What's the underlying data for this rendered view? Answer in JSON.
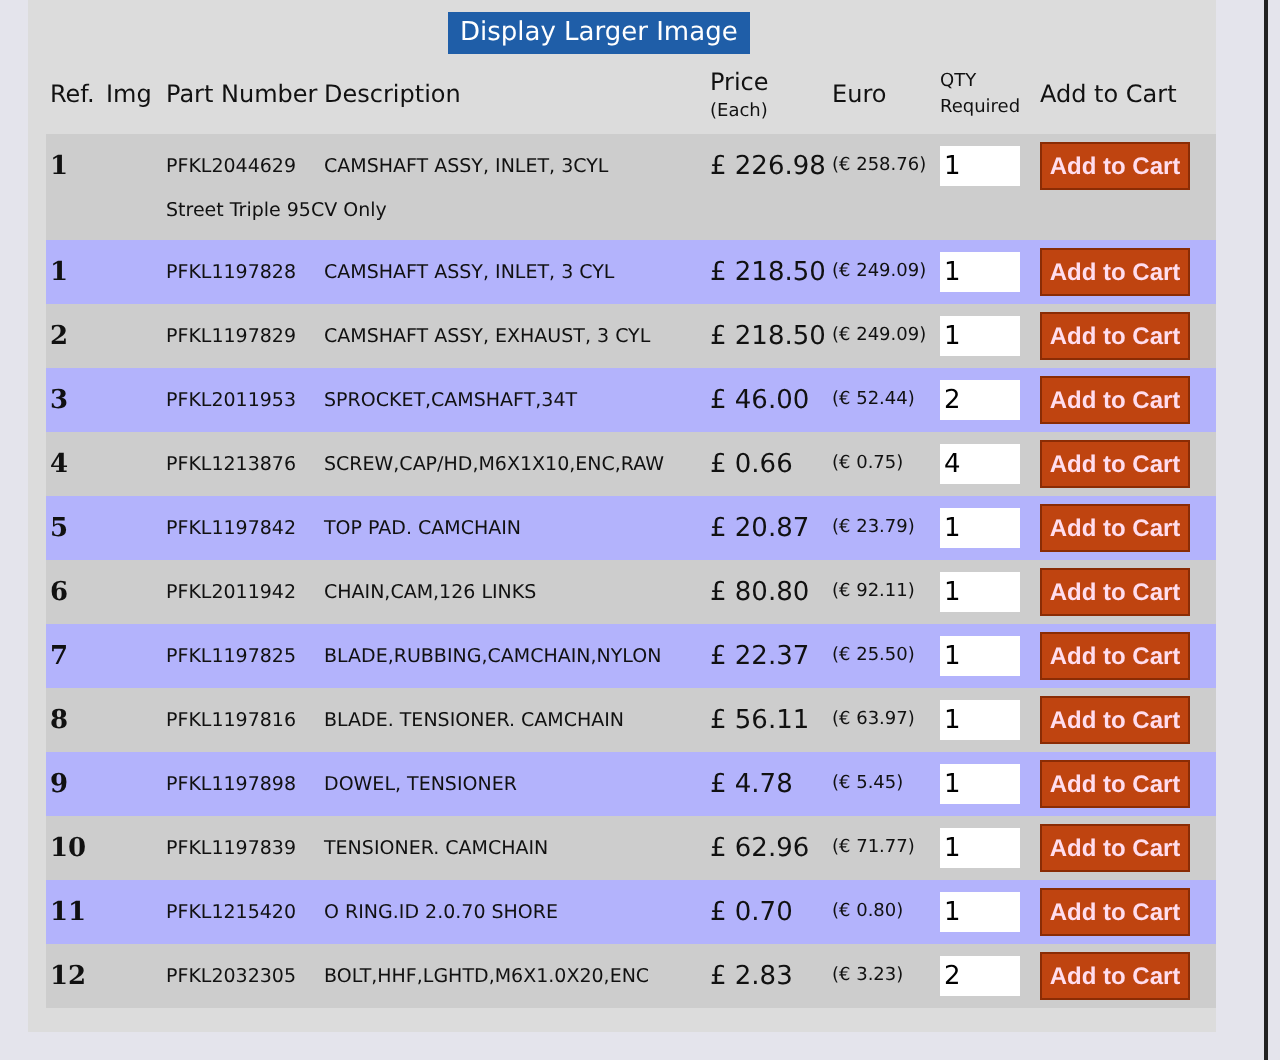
{
  "display_button": "Display Larger Image",
  "columns": [
    {
      "label": "Ref."
    },
    {
      "label": "Img"
    },
    {
      "label": "Part Number"
    },
    {
      "label": "Description"
    },
    {
      "label": "Price",
      "sub": "(Each)"
    },
    {
      "label": "Euro"
    },
    {
      "label": "QTY",
      "sub": "Required"
    },
    {
      "label": "Add to Cart"
    }
  ],
  "rows": [
    {
      "ref": "1",
      "part": "PFKL2044629",
      "description": "CAMSHAFT ASSY, INLET, 3CYL",
      "price": "£ 226.98",
      "euro": "(€ 258.76)",
      "qty": "1",
      "button": "Add to Cart",
      "note": "Street Triple 95CV Only"
    },
    {
      "ref": "1",
      "part": "PFKL1197828",
      "description": "CAMSHAFT ASSY, INLET, 3 CYL",
      "price": "£ 218.50",
      "euro": "(€ 249.09)",
      "qty": "1",
      "button": "Add to Cart"
    },
    {
      "ref": "2",
      "part": "PFKL1197829",
      "description": "CAMSHAFT ASSY, EXHAUST, 3 CYL",
      "price": "£ 218.50",
      "euro": "(€ 249.09)",
      "qty": "1",
      "button": "Add to Cart"
    },
    {
      "ref": "3",
      "part": "PFKL2011953",
      "description": "SPROCKET,CAMSHAFT,34T",
      "price": "£ 46.00",
      "euro": "(€ 52.44)",
      "qty": "2",
      "button": "Add to Cart"
    },
    {
      "ref": "4",
      "part": "PFKL1213876",
      "description": "SCREW,CAP/HD,M6X1X10,ENC,RAW",
      "price": "£ 0.66",
      "euro": "(€ 0.75)",
      "qty": "4",
      "button": "Add to Cart"
    },
    {
      "ref": "5",
      "part": "PFKL1197842",
      "description": "TOP PAD. CAMCHAIN",
      "price": "£ 20.87",
      "euro": "(€ 23.79)",
      "qty": "1",
      "button": "Add to Cart"
    },
    {
      "ref": "6",
      "part": "PFKL2011942",
      "description": "CHAIN,CAM,126 LINKS",
      "price": "£ 80.80",
      "euro": "(€ 92.11)",
      "qty": "1",
      "button": "Add to Cart"
    },
    {
      "ref": "7",
      "part": "PFKL1197825",
      "description": "BLADE,RUBBING,CAMCHAIN,NYLON",
      "price": "£ 22.37",
      "euro": "(€ 25.50)",
      "qty": "1",
      "button": "Add to Cart"
    },
    {
      "ref": "8",
      "part": "PFKL1197816",
      "description": "BLADE. TENSIONER. CAMCHAIN",
      "price": "£ 56.11",
      "euro": "(€ 63.97)",
      "qty": "1",
      "button": "Add to Cart"
    },
    {
      "ref": "9",
      "part": "PFKL1197898",
      "description": "DOWEL, TENSIONER",
      "price": "£ 4.78",
      "euro": "(€ 5.45)",
      "qty": "1",
      "button": "Add to Cart"
    },
    {
      "ref": "10",
      "part": "PFKL1197839",
      "description": "TENSIONER. CAMCHAIN",
      "price": "£ 62.96",
      "euro": "(€ 71.77)",
      "qty": "1",
      "button": "Add to Cart"
    },
    {
      "ref": "11",
      "part": "PFKL1215420",
      "description": "O RING.ID 2.0.70 SHORE",
      "price": "£ 0.70",
      "euro": "(€ 0.80)",
      "qty": "1",
      "button": "Add to Cart"
    },
    {
      "ref": "12",
      "part": "PFKL2032305",
      "description": "BOLT,HHF,LGHTD,M6X1.0X20,ENC",
      "price": "£ 2.83",
      "euro": "(€ 3.23)",
      "qty": "2",
      "button": "Add to Cart"
    }
  ]
}
